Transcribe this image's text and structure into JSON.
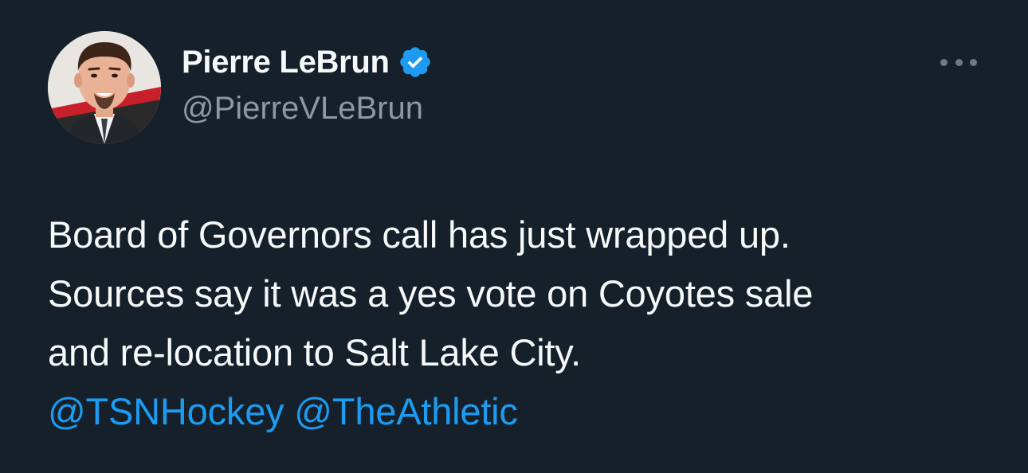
{
  "author": {
    "display_name": "Pierre LeBrun",
    "handle": "@PierreVLeBrun",
    "verified": true,
    "verified_color": "#1d9bf0"
  },
  "tweet": {
    "lines": [
      "Board of Governors call has just wrapped up.",
      "Sources say it was a yes vote on Coyotes sale",
      "and re-location to Salt Lake City."
    ],
    "mentions": [
      "@TSNHockey",
      "@TheAthletic"
    ]
  },
  "theme": {
    "background": "#15202b",
    "text": "#f7f9f9",
    "secondary_text": "#8b98a5",
    "link": "#1d9bf0"
  },
  "icons": {
    "verified": "verified-badge-icon",
    "more": "more-options-icon"
  }
}
